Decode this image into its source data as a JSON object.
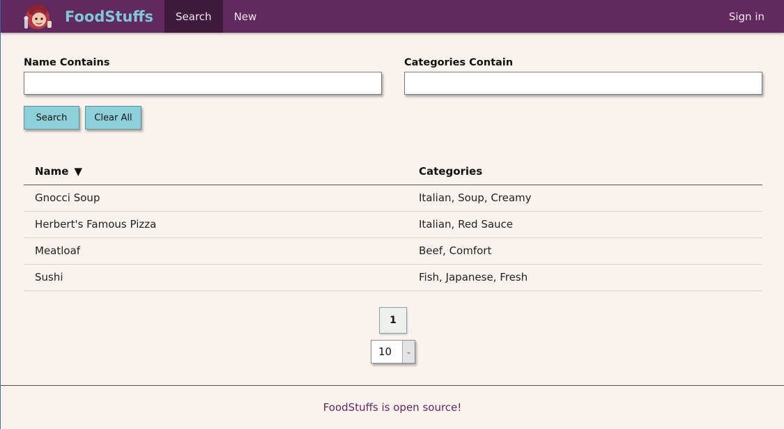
{
  "navbar": {
    "brand": "FoodStuffs",
    "items": [
      {
        "label": "Search",
        "active": true
      },
      {
        "label": "New",
        "active": false
      }
    ],
    "sign_in": "Sign in",
    "logo_icon": "chef-avatar-logo"
  },
  "search": {
    "name_label": "Name Contains",
    "name_value": "",
    "categories_label": "Categories Contain",
    "categories_value": "",
    "search_button": "Search",
    "clear_button": "Clear All"
  },
  "table": {
    "columns": [
      {
        "label": "Name",
        "sort": "descending"
      },
      {
        "label": "Categories"
      }
    ],
    "rows": [
      {
        "name": "Gnocci Soup",
        "categories": "Italian, Soup, Creamy"
      },
      {
        "name": "Herbert's Famous Pizza",
        "categories": "Italian, Red Sauce"
      },
      {
        "name": "Meatloaf",
        "categories": "Beef, Comfort"
      },
      {
        "name": "Sushi",
        "categories": "Fish, Japanese, Fresh"
      }
    ],
    "sort_icon": "▼"
  },
  "pagination": {
    "current_page": "1",
    "page_size": "10"
  },
  "footer": {
    "text": "FoodStuffs is open source!"
  },
  "colors": {
    "navbar_bg": "#61295e",
    "navbar_active": "#3e1a3c",
    "brand_text": "#7fc7d9",
    "button_bg": "#8ed0da",
    "page_bg": "#faf2ed",
    "footer_text": "#61295e"
  }
}
